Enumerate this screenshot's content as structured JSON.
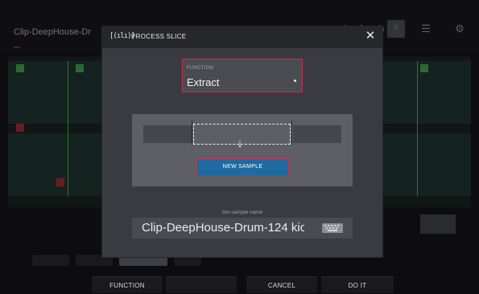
{
  "background": {
    "clip_title": "Clip-DeepHouse-Dr",
    "top_icons": [
      "undo-icon",
      "redo-icon",
      "grid-icon",
      "zoom-icon",
      "list-icon",
      "settings-icon"
    ],
    "side_button_label": "",
    "chips": [
      "",
      "",
      "",
      "",
      ""
    ]
  },
  "dialog": {
    "icon_glyph": "[(ılı)]",
    "title": "PROCESS SLICE",
    "close_glyph": "✕",
    "function": {
      "caption": "FUNCTION",
      "value": "Extract"
    },
    "diagram": {
      "arrow_glyph": "↓",
      "button_label": "NEW SAMPLE"
    },
    "name": {
      "caption": "Set sample name",
      "value": "Clip-DeepHouse-Drum-124 kicl"
    }
  },
  "footer": {
    "function_label": "FUNCTION",
    "cancel_label": "CANCEL",
    "do_it_label": "DO IT"
  },
  "colors": {
    "accent_red": "#c2324a",
    "button_blue": "#1f6aa0",
    "dialog_bg": "#3a3b40",
    "waveform_green": "#25403a"
  }
}
